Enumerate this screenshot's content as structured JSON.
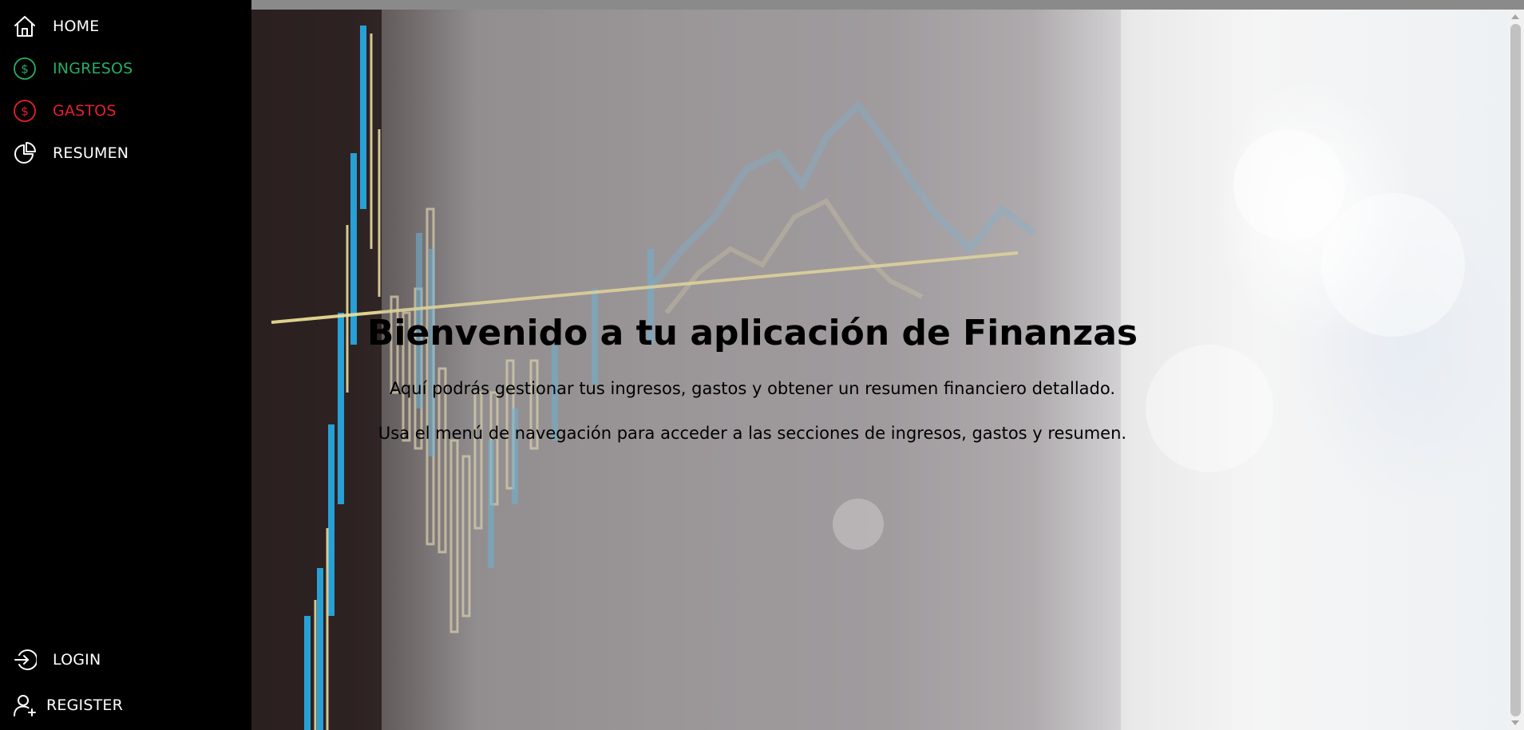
{
  "sidebar": {
    "top_items": [
      {
        "label": "HOME",
        "icon": "home-icon",
        "color": "#ffffff"
      },
      {
        "label": "INGRESOS",
        "icon": "dollar-circle-icon",
        "color": "#27ae60"
      },
      {
        "label": "GASTOS",
        "icon": "dollar-circle-icon",
        "color": "#e5202b"
      },
      {
        "label": "RESUMEN",
        "icon": "pie-chart-icon",
        "color": "#ffffff"
      }
    ],
    "bottom_items": [
      {
        "label": "LOGIN",
        "icon": "login-icon",
        "color": "#ffffff"
      },
      {
        "label": "REGISTER",
        "icon": "user-add-icon",
        "color": "#ffffff"
      }
    ]
  },
  "hero": {
    "title": "Bienvenido a tu aplicación de Finanzas",
    "subtitle_1": "Aquí podrás gestionar tus ingresos, gastos y obtener un resumen financiero detallado.",
    "subtitle_2": "Usa el menú de navegación para acceder a las secciones de ingresos, gastos y resumen."
  },
  "colors": {
    "sidebar_bg": "#000000",
    "ingresos": "#27ae60",
    "gastos": "#e5202b",
    "text": "#ffffff"
  }
}
